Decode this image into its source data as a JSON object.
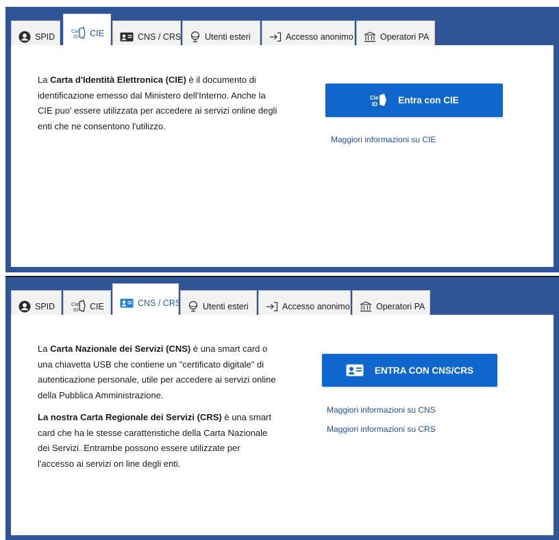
{
  "panel_cie": {
    "tabs": [
      {
        "label": "SPID",
        "icon": "user-circle-icon"
      },
      {
        "label": "CIE",
        "icon": "cie-id-icon"
      },
      {
        "label": "CNS / CRS",
        "icon": "id-card-icon"
      },
      {
        "label": "Utenti esteri",
        "icon": "globe-icon"
      },
      {
        "label": "Accesso anonimo",
        "icon": "arrow-login-icon"
      },
      {
        "label": "Operatori PA",
        "icon": "institution-icon"
      }
    ],
    "active_tab": "CIE",
    "description": {
      "prefix": "La ",
      "bold": "Carta d'Identità Elettronica (CIE)",
      "rest": " è il documento di identificazione emesso dal Ministero dell'Interno. Anche la CIE puo' essere utilizzata per accedere ai servizi online degli enti che ne consentono l'utilizzo."
    },
    "login_button": "Entra con CIE",
    "info_link": "Maggiori informazioni su CIE"
  },
  "panel_cns": {
    "tabs": [
      {
        "label": "SPID",
        "icon": "user-circle-icon"
      },
      {
        "label": "CIE",
        "icon": "cie-id-icon"
      },
      {
        "label": "CNS / CRS",
        "icon": "id-card-icon"
      },
      {
        "label": "Utenti esteri",
        "icon": "globe-icon"
      },
      {
        "label": "Accesso anonimo",
        "icon": "arrow-login-icon"
      },
      {
        "label": "Operatori PA",
        "icon": "institution-icon"
      }
    ],
    "active_tab": "CNS / CRS",
    "description_cns": {
      "prefix": "La ",
      "bold": "Carta Nazionale dei Servizi (CNS)",
      "rest": " è una smart card o una chiavetta USB che contiene un \"certificato digitale\" di autenticazione personale, utile per accedere ai servizi online della Pubblica Amministrazione."
    },
    "description_crs": {
      "bold": "La nostra Carta Regionale dei Servizi (CRS)",
      "rest": " è una smart card che ha le stesse caratteristiche della Carta Nazionale dei Servizi. Entrambe possono essere utilizzate per l'accesso ai servizi on line degli enti."
    },
    "login_button": "ENTRA CON CNS/CRS",
    "info_link_cns": "Maggiori informazioni su CNS",
    "info_link_crs": "Maggiori informazioni su CRS"
  },
  "colors": {
    "frame": "#2f5597",
    "button": "#0f66cc",
    "link": "#1f4f9e",
    "active_tab_text": "#1f5ea8"
  }
}
